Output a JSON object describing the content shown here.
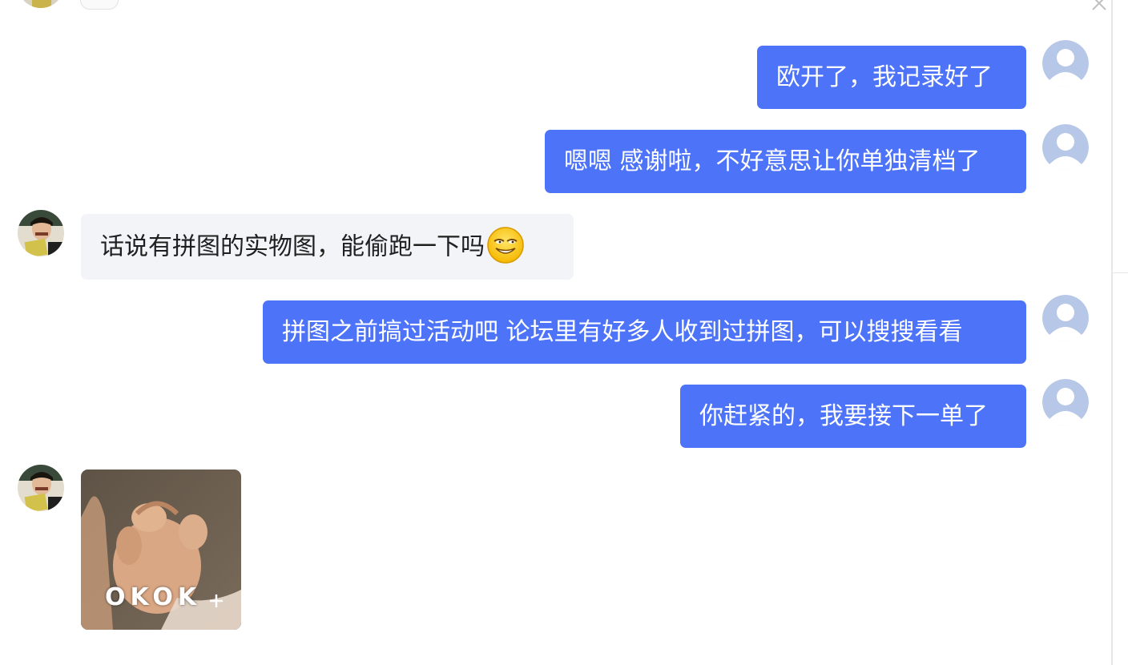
{
  "messages": [
    {
      "sender": "me",
      "text": "欧开了，我记录好了"
    },
    {
      "sender": "me",
      "text": "嗯嗯 感谢啦，不好意思让你单独清档了"
    },
    {
      "sender": "other",
      "text": "话说有拼图的实物图，能偷跑一下吗",
      "emoji": "grinning-face-emoji"
    },
    {
      "sender": "me",
      "text": "拼图之前搞过活动吧 论坛里有好多人收到过拼图，可以搜搜看看"
    },
    {
      "sender": "me",
      "text": "你赶紧的，我要接下一单了"
    },
    {
      "sender": "other",
      "type": "sticker",
      "caption": "OKOK"
    }
  ],
  "avatars": {
    "me": "default-user-avatar-icon",
    "other": "user-photo-avatar"
  },
  "colors": {
    "my_bubble": "#4d73f8",
    "other_bubble": "#f3f4f8",
    "default_avatar": "#b7c7e7"
  },
  "icons": {
    "close": "close-icon",
    "add_sticker": "plus-icon"
  }
}
